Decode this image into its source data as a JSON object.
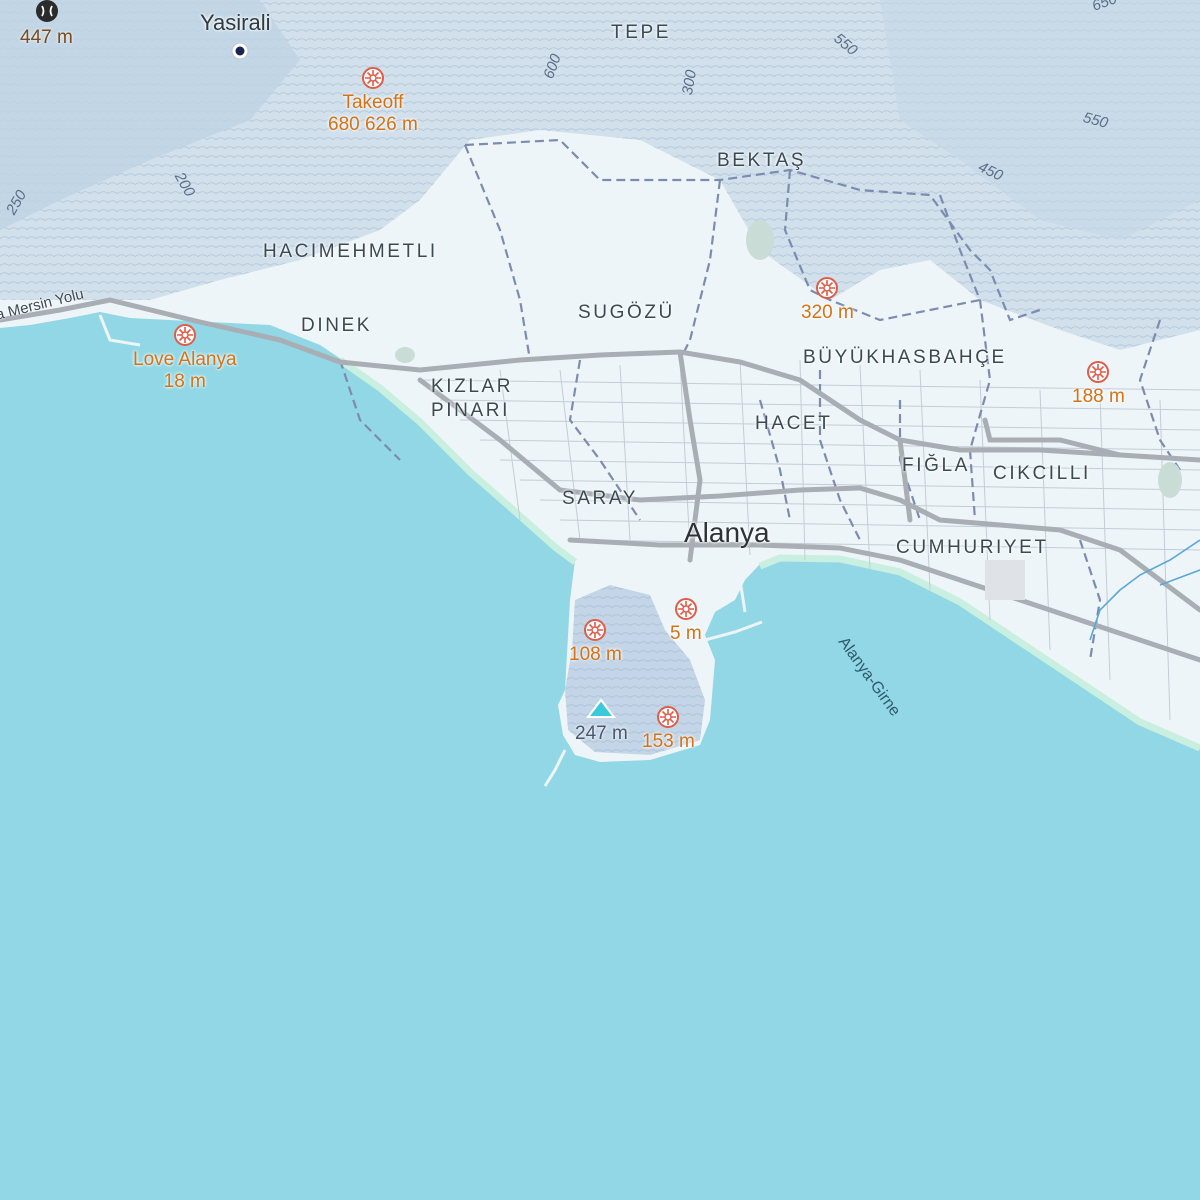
{
  "map": {
    "colors": {
      "sea": "#91d7e6",
      "land": "#eef5f8",
      "hills": "#b9cfe0",
      "road": "#a9aeb4",
      "path": "#7c8cb0",
      "poi": "#e05c4a",
      "poi_text": "#d47316"
    },
    "settlements": {
      "city": "Alanya",
      "village": "Yasirali"
    },
    "districts": {
      "tepe": "TEPE",
      "bektas": "BEKTAŞ",
      "hacimehmetli": "HACIMEHMETLI",
      "dinek": "DINEK",
      "sugozu": "SUGÖZÜ",
      "buyukhasbahce": "BÜYÜKHASBAHÇE",
      "kizlar": "KIZLAR",
      "pinari": "PINARI",
      "hacet": "HACET",
      "figla": "FIĞLA",
      "cikcilli": "CIKCILLI",
      "saray": "SARAY",
      "cumhuriyet": "CUMHURIYET"
    },
    "pois": {
      "takeoff": {
        "name": "Takeoff",
        "elevation": "680 626 m",
        "icon": "paraglide-icon"
      },
      "love_alanya": {
        "name": "Love Alanya",
        "elevation": "18 m",
        "icon": "paraglide-icon"
      },
      "p320": {
        "elevation": "320 m",
        "icon": "paraglide-icon"
      },
      "p188": {
        "elevation": "188 m",
        "icon": "paraglide-icon"
      },
      "p108": {
        "elevation": "108 m",
        "icon": "paraglide-icon"
      },
      "p5": {
        "elevation": "5 m",
        "icon": "paraglide-icon"
      },
      "p153": {
        "elevation": "153 m",
        "icon": "paraglide-icon"
      }
    },
    "peak": {
      "elevation": "247 m",
      "icon": "mountain-peak-icon"
    },
    "corner_marker": {
      "elevation": "447 m",
      "icon": "pass-icon"
    },
    "roads": {
      "mersin": "a Mersin Yolu"
    },
    "sea_route": "Alanya-Girne",
    "contour_labels": [
      "650",
      "550",
      "550",
      "450",
      "600",
      "300",
      "250",
      "200"
    ]
  }
}
